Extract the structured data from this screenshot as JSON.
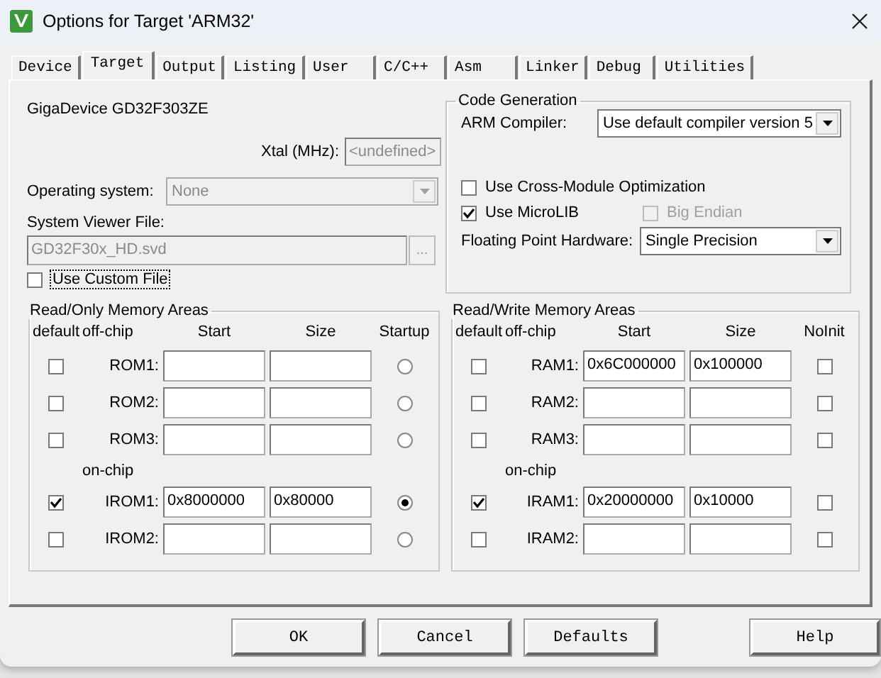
{
  "window": {
    "title": "Options for Target 'ARM32'"
  },
  "tabs": [
    {
      "label": "Device",
      "selected": false
    },
    {
      "label": "Target",
      "selected": true
    },
    {
      "label": "Output",
      "selected": false
    },
    {
      "label": "Listing",
      "selected": false
    },
    {
      "label": "User",
      "selected": false
    },
    {
      "label": "C/C++",
      "selected": false
    },
    {
      "label": "Asm",
      "selected": false
    },
    {
      "label": "Linker",
      "selected": false
    },
    {
      "label": "Debug",
      "selected": false
    },
    {
      "label": "Utilities",
      "selected": false
    }
  ],
  "device": {
    "name": "GigaDevice GD32F303ZE",
    "xtal_label": "Xtal (MHz):",
    "xtal_value": "<undefined>",
    "xtal_disabled": true,
    "os_label": "Operating system:",
    "os_value": "None",
    "os_disabled": true,
    "svd_label": "System Viewer File:",
    "svd_value": "GD32F30x_HD.svd",
    "svd_disabled": true,
    "browse": "...",
    "custom_file": {
      "label": "Use Custom File",
      "checked": false,
      "focused": true
    }
  },
  "code_generation": {
    "title": "Code Generation",
    "compiler_label": "ARM Compiler:",
    "compiler_value": "Use default compiler version 5",
    "cross_module": {
      "label": "Use Cross-Module Optimization",
      "checked": false,
      "disabled": false
    },
    "microlib": {
      "label": "Use MicroLIB",
      "checked": true,
      "disabled": false
    },
    "big_endian": {
      "label": "Big Endian",
      "checked": false,
      "disabled": true
    },
    "fpu_label": "Floating Point Hardware:",
    "fpu_value": "Single Precision"
  },
  "memory_groups": [
    {
      "kind": "read_only",
      "title": "Read/Only Memory Areas",
      "columns": [
        "default",
        "off-chip",
        "Start",
        "Size",
        "Startup"
      ],
      "on_chip_label": "on-chip",
      "off_chip_rows": [
        {
          "name": "ROM1:",
          "default": false,
          "startup": false
        },
        {
          "name": "ROM2:",
          "default": false,
          "startup": false
        },
        {
          "name": "ROM3:",
          "default": false,
          "startup": false
        }
      ],
      "on_chip_rows": [
        {
          "name": "IROM1:",
          "default": true,
          "start": "0x8000000",
          "size": "0x80000",
          "startup": true
        },
        {
          "name": "IROM2:",
          "default": false,
          "startup": false
        }
      ]
    },
    {
      "kind": "read_write",
      "title": "Read/Write Memory Areas",
      "columns": [
        "default",
        "off-chip",
        "Start",
        "Size",
        "NoInit"
      ],
      "on_chip_label": "on-chip",
      "off_chip_rows": [
        {
          "name": "RAM1:",
          "default": false,
          "start": "0x6C000000",
          "size": "0x100000",
          "noinit": false
        },
        {
          "name": "RAM2:",
          "default": false,
          "noinit": false
        },
        {
          "name": "RAM3:",
          "default": false,
          "noinit": false
        }
      ],
      "on_chip_rows": [
        {
          "name": "IRAM1:",
          "default": true,
          "start": "0x20000000",
          "size": "0x10000",
          "noinit": false
        },
        {
          "name": "IRAM2:",
          "default": false,
          "noinit": false
        }
      ]
    }
  ],
  "buttons": [
    "OK",
    "Cancel",
    "Defaults",
    "Help"
  ]
}
